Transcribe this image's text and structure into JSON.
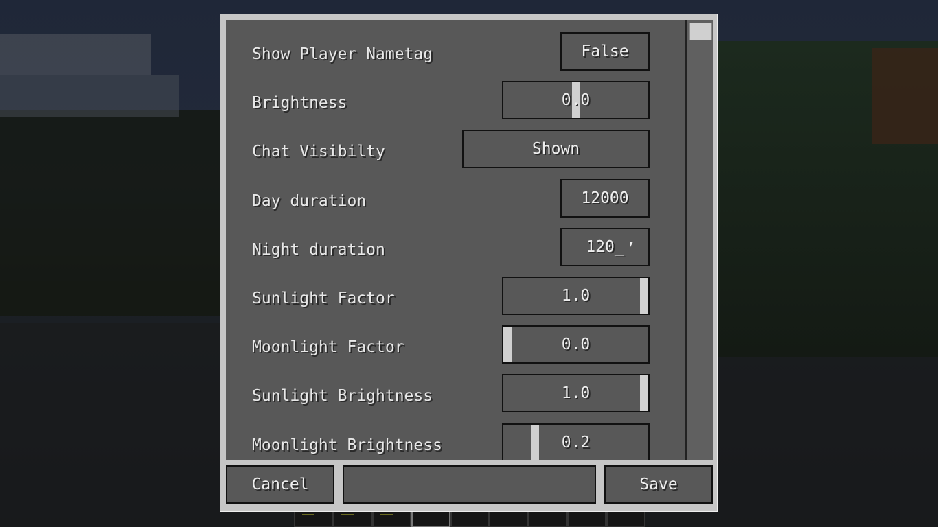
{
  "settings": [
    {
      "label": "Show Player Nametag",
      "type": "button",
      "value": "False"
    },
    {
      "label": "Brightness",
      "type": "slider",
      "value": "0.0",
      "fraction": 0.5
    },
    {
      "label": "Chat Visibilty",
      "type": "button",
      "value": "Shown"
    },
    {
      "label": "Day duration",
      "type": "text",
      "value": "12000"
    },
    {
      "label": "Night duration",
      "type": "text",
      "value": "120_"
    },
    {
      "label": "Sunlight Factor",
      "type": "slider",
      "value": "1.0",
      "fraction": 1.0
    },
    {
      "label": "Moonlight Factor",
      "type": "slider",
      "value": "0.0",
      "fraction": 0.0
    },
    {
      "label": "Sunlight Brightness",
      "type": "slider",
      "value": "1.0",
      "fraction": 1.0
    },
    {
      "label": "Moonlight Brightness",
      "type": "slider",
      "value": "0.2",
      "fraction": 0.2
    }
  ],
  "footer": {
    "cancel": "Cancel",
    "save": "Save",
    "middle": ""
  },
  "scroll": {
    "position": 0
  }
}
